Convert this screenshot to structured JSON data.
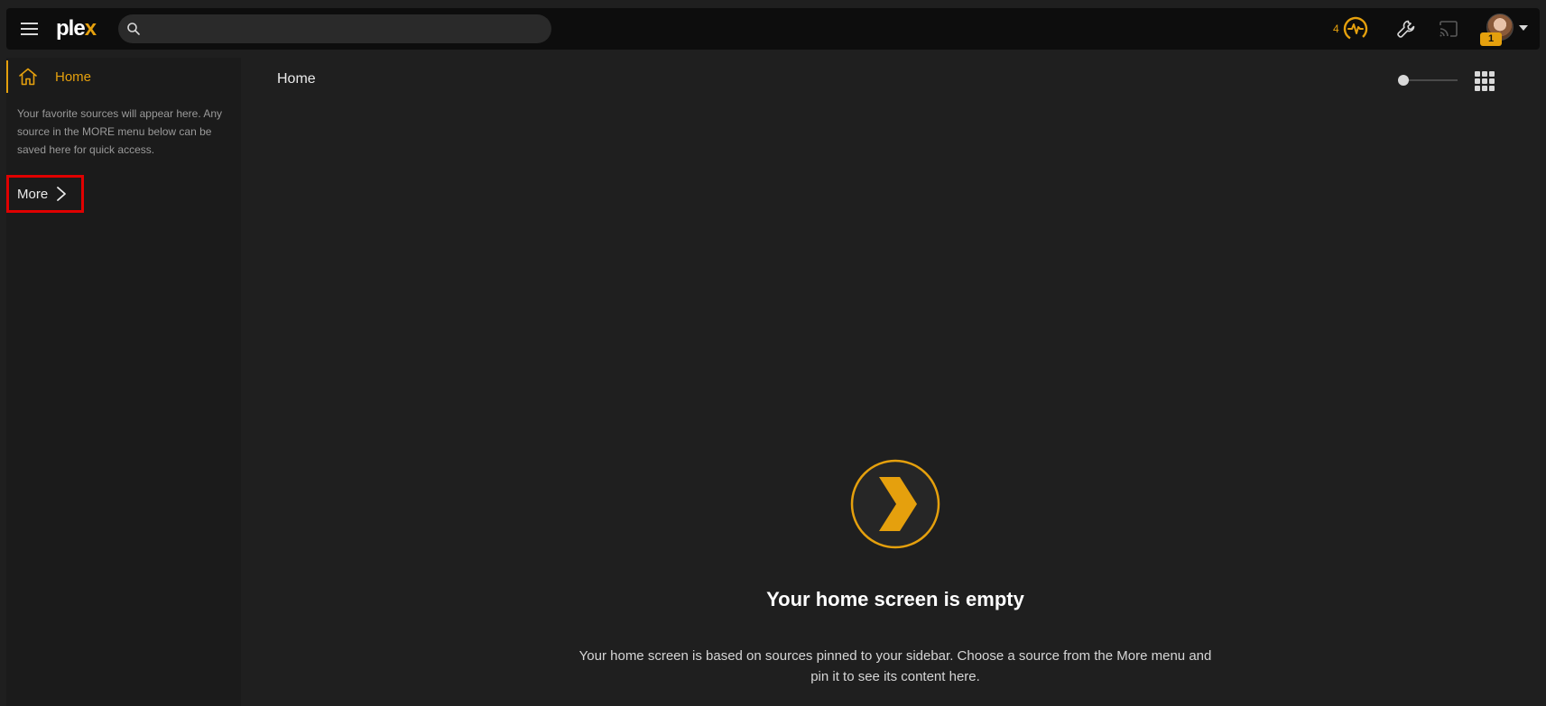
{
  "app": {
    "logo_main": "ple",
    "logo_accent": "x"
  },
  "topbar": {
    "search": {
      "placeholder": "",
      "value": ""
    },
    "activity_count": "4",
    "notification_badge": "1",
    "icons": [
      "menu-icon",
      "search-icon",
      "activity-icon",
      "wrench-icon",
      "cast-icon",
      "chevron-down-icon"
    ]
  },
  "sidebar": {
    "home_label": "Home",
    "help_text": "Your favorite sources will appear here. Any source in the MORE menu below can be saved here for quick access.",
    "more_label": "More"
  },
  "main": {
    "title": "Home",
    "empty_title": "Your home screen is empty",
    "empty_description": "Your home screen is based on sources pinned to your sidebar. Choose a source from the More menu and pin it to see its content here."
  },
  "colors": {
    "accent": "#e5a00d",
    "background": "#1f1f1f",
    "topbar": "#0d0d0d",
    "highlight_box": "#e00000"
  }
}
